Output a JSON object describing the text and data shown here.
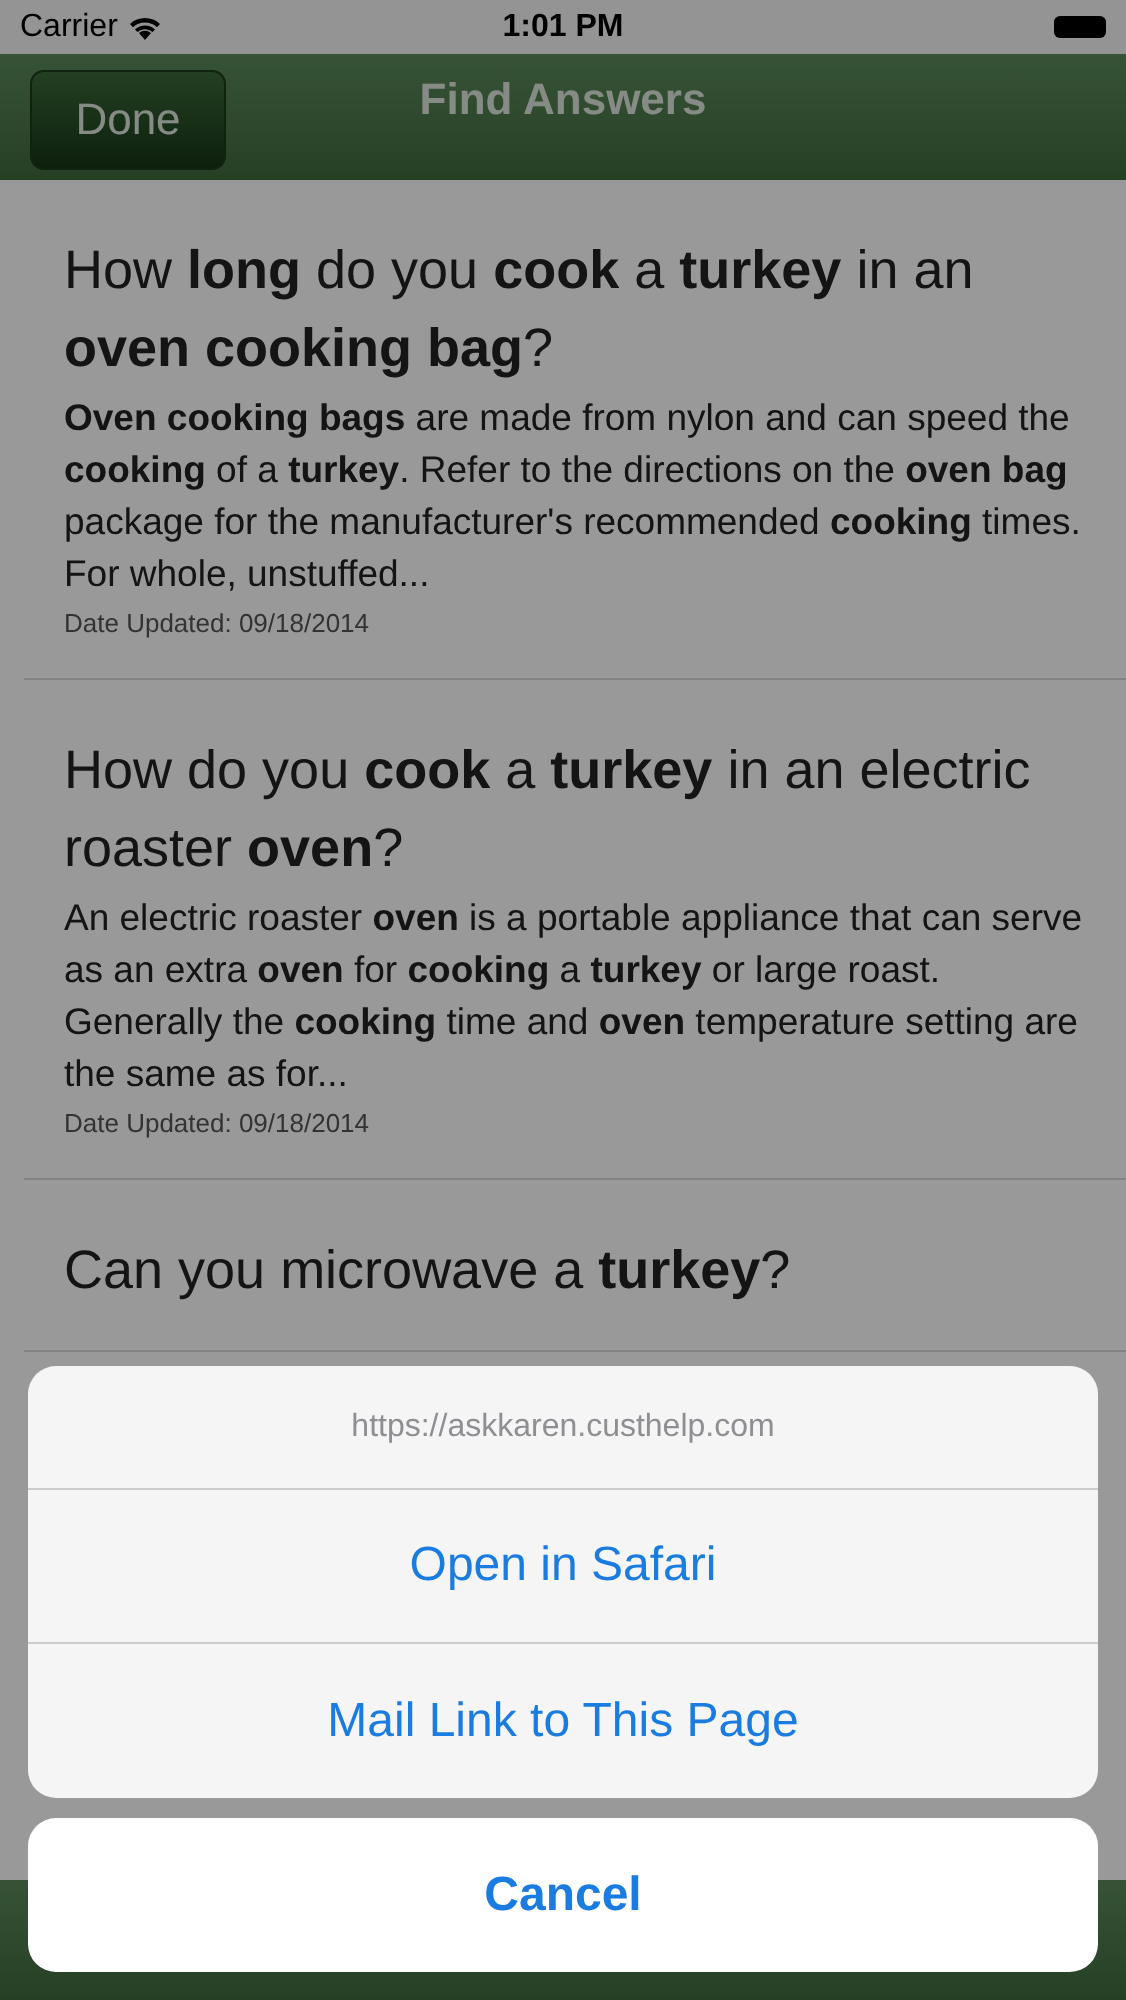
{
  "status_bar": {
    "carrier": "Carrier",
    "time": "1:01 PM"
  },
  "nav": {
    "title": "Find Answers",
    "done": "Done"
  },
  "articles": [
    {
      "title": "How **long** do you **cook** a **turkey** in an **oven cooking bag**?",
      "body": "**Oven cooking bags** are made from nylon and can speed the **cooking** of a **turkey**. Refer to the directions on the **oven bag** package for the manufacturer's recommended **cooking** times. For whole, unstuffed...",
      "date": "Date Updated: 09/18/2014"
    },
    {
      "title": "How do you **cook** a **turkey** in an electric roaster **oven**?",
      "body": "An electric roaster **oven** is a portable appliance that can serve as an extra **oven** for **cooking** a **turkey** or large roast. Generally the **cooking** time and **oven** temperature setting are the same as for...",
      "date": "Date Updated: 09/18/2014"
    },
    {
      "title": "Can you microwave a **turkey**?"
    }
  ],
  "action_sheet": {
    "url": "https://askkaren.custhelp.com",
    "actions": [
      "Open in Safari",
      "Mail Link to This Page"
    ],
    "cancel": "Cancel"
  }
}
